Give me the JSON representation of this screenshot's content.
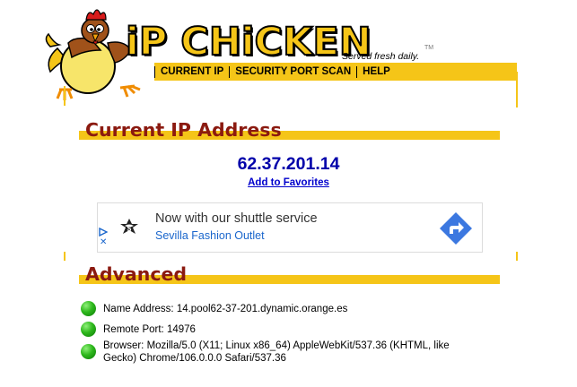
{
  "header": {
    "logo_text": "iP CHiCKEN",
    "tagline": "Served fresh daily.",
    "trademark": "TM",
    "nav": [
      {
        "label": "CURRENT IP"
      },
      {
        "label": "SECURITY PORT SCAN"
      },
      {
        "label": "HELP"
      }
    ]
  },
  "current_ip": {
    "heading": "Current IP Address",
    "ip": "62.37.201.14",
    "favorites_link": "Add to Favorites"
  },
  "ad": {
    "title": "Now with our shuttle service",
    "subtitle": "Sevilla Fashion Outlet",
    "close_glyph": "✕",
    "cta_icon": "directions-arrow-icon"
  },
  "advanced": {
    "heading": "Advanced",
    "rows": [
      {
        "text": "Name Address: 14.pool62-37-201.dynamic.orange.es"
      },
      {
        "text": "Remote Port: 14976"
      },
      {
        "text": "Browser: Mozilla/5.0 (X11; Linux x86_64) AppleWebKit/537.36 (KHTML, like Gecko) Chrome/106.0.0.0 Safari/537.36"
      }
    ]
  },
  "colors": {
    "yellow": "#f5c518",
    "heading_red": "#8b1a10",
    "ip_blue": "#0000aa",
    "status_green": "#2eb81c"
  }
}
